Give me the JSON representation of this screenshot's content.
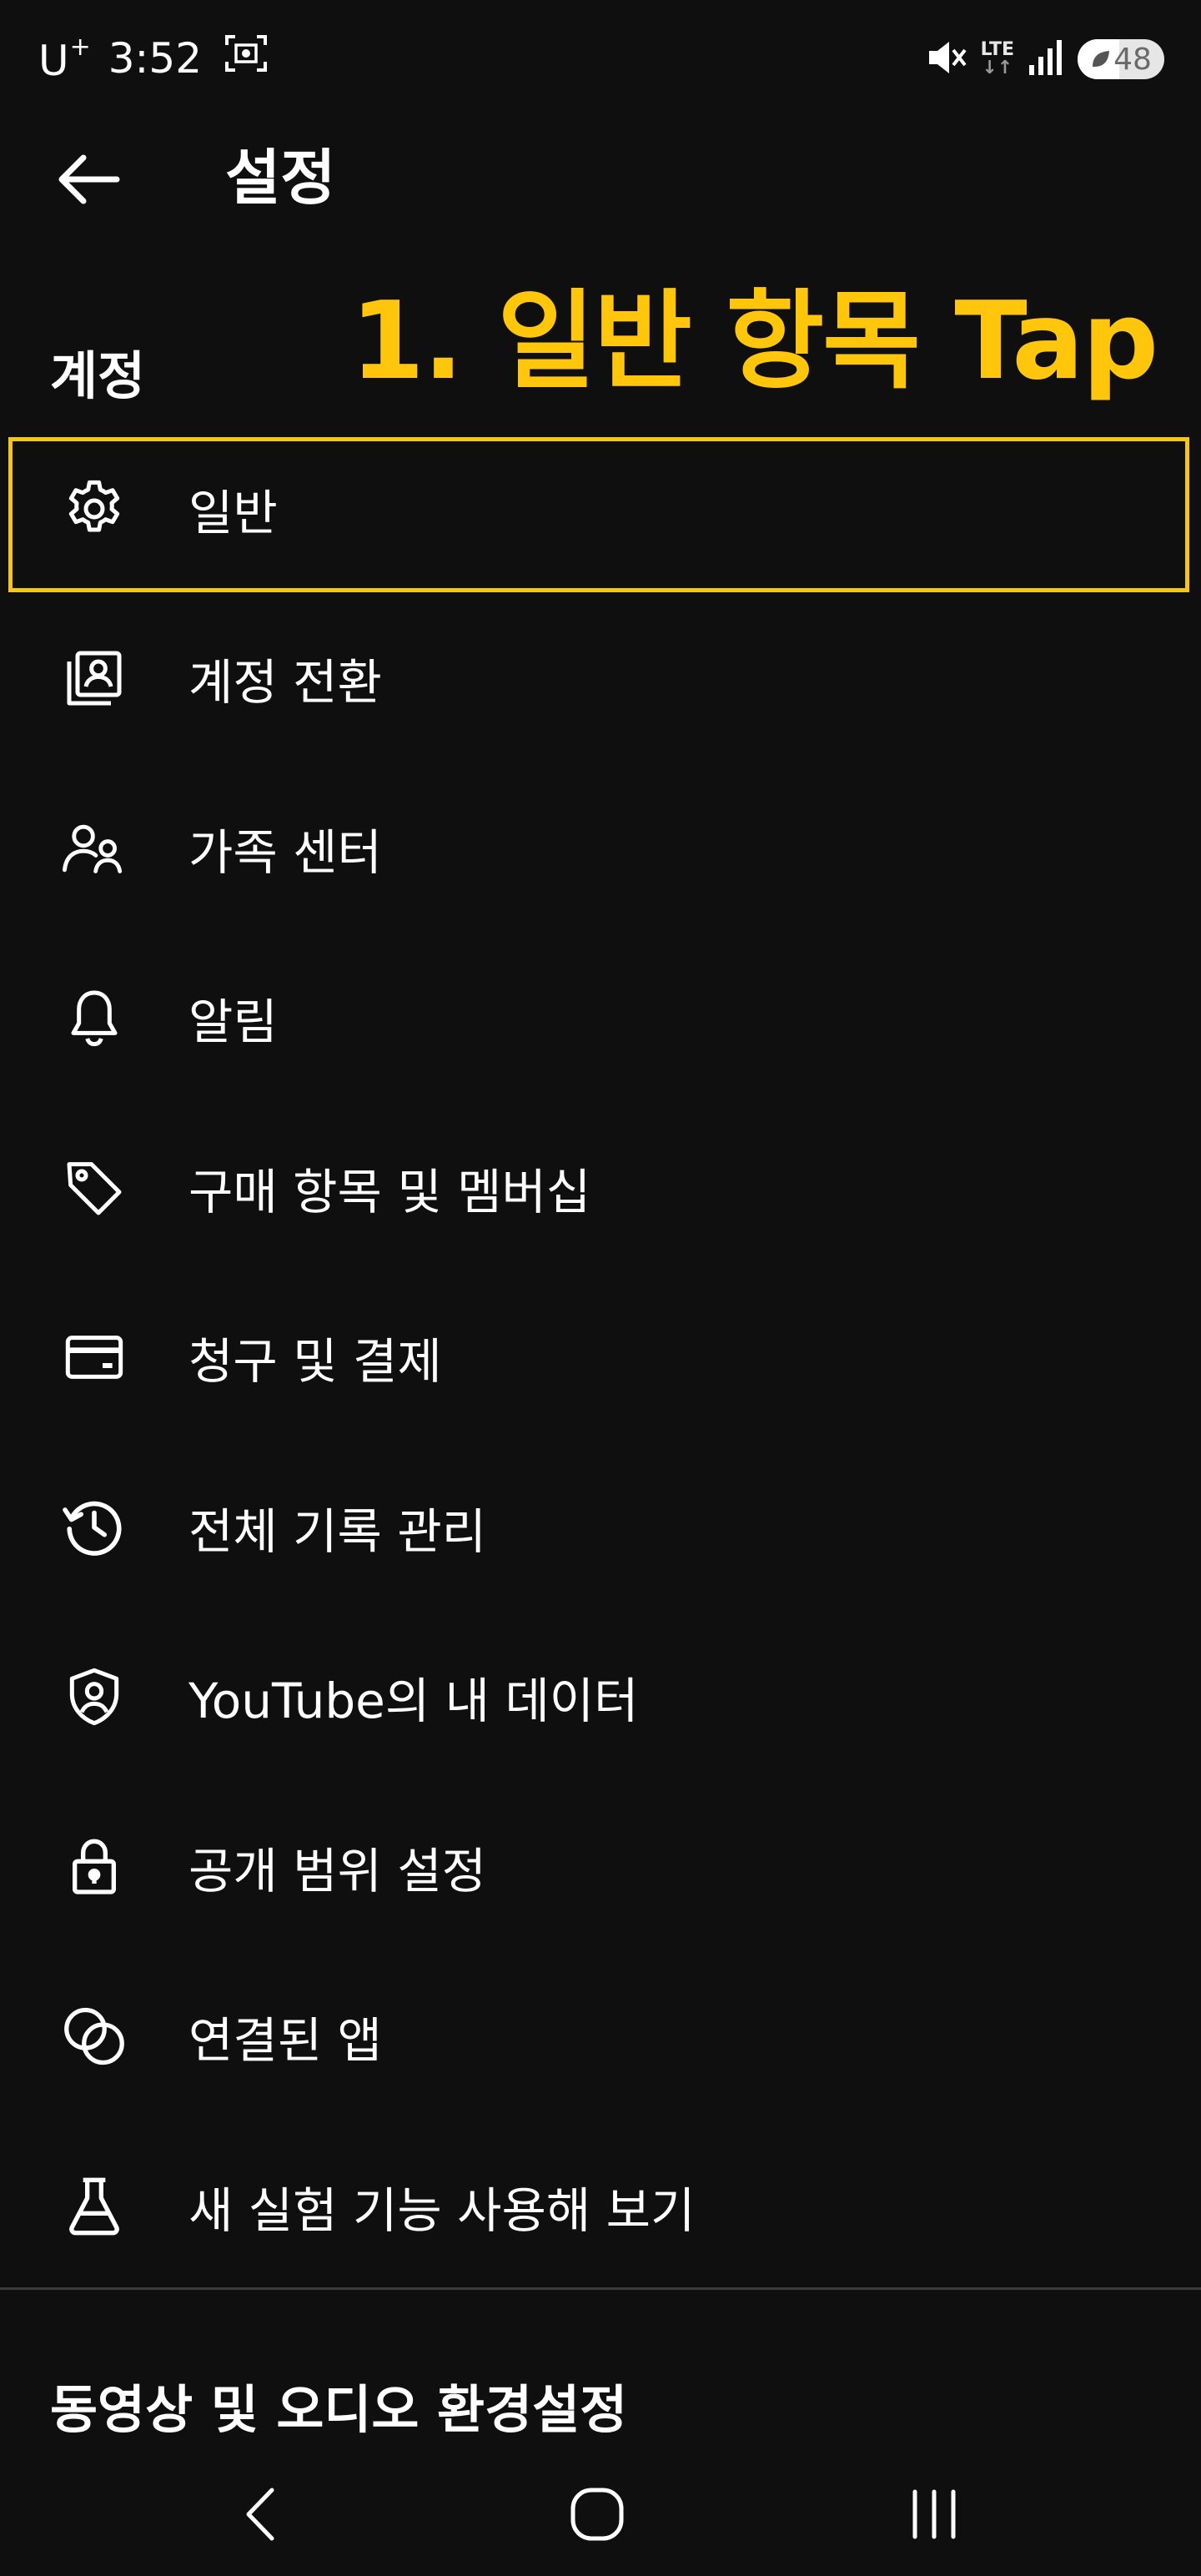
{
  "status_bar": {
    "carrier": "U",
    "carrier_sup": "+",
    "time": "3:52",
    "network": "LTE",
    "network_arrows": "↓↑",
    "battery": "48",
    "battery_level": 0.48
  },
  "app_bar": {
    "title": "설정"
  },
  "annotation": {
    "text": "1. 일반 항목 Tap",
    "color": "#ffc60b"
  },
  "sections": {
    "account": "계정",
    "video_audio": "동영상 및 오디오 환경설정"
  },
  "menu": {
    "items": [
      {
        "label": "일반",
        "icon": "gear-icon"
      },
      {
        "label": "계정 전환",
        "icon": "switch-account-icon"
      },
      {
        "label": "가족 센터",
        "icon": "family-icon"
      },
      {
        "label": "알림",
        "icon": "bell-icon"
      },
      {
        "label": "구매 항목 및 멤버십",
        "icon": "tag-icon"
      },
      {
        "label": "청구 및 결제",
        "icon": "credit-card-icon"
      },
      {
        "label": "전체 기록 관리",
        "icon": "history-icon"
      },
      {
        "label": "YouTube의 내 데이터",
        "icon": "shield-person-icon"
      },
      {
        "label": "공개 범위 설정",
        "icon": "lock-icon"
      },
      {
        "label": "연결된 앱",
        "icon": "linked-apps-icon"
      },
      {
        "label": "새 실험 기능 사용해 보기",
        "icon": "flask-icon"
      }
    ]
  }
}
